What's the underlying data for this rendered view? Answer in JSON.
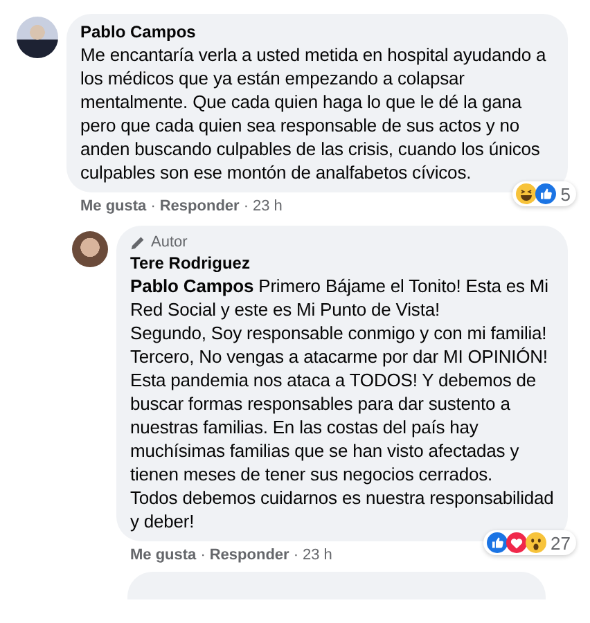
{
  "comments": [
    {
      "author": "Pablo Campos",
      "reply": false,
      "paragraphs": [
        "Me encantaría verla a usted metida en hospital ayudando a los médicos que ya están empezando a colapsar mentalmente. Que cada quien haga lo que le dé la gana pero que cada quien sea responsable de sus actos y no anden buscando culpables de las crisis, cuando los únicos culpables son ese montón de analfabetos cívicos."
      ],
      "reactions": [
        {
          "kind": "haha"
        },
        {
          "kind": "like"
        }
      ],
      "reaction_count": "5",
      "actions": [
        "Me gusta",
        "Responder"
      ],
      "separator": "·",
      "time": "23 h"
    },
    {
      "author": "Tere Rodriguez",
      "badge": "Autor",
      "reply": true,
      "paragraphs": [
        "**Pablo Campos** Primero Bájame el Tonito! Esta es Mi Red Social y este es Mi Punto de Vista!",
        "Segundo, Soy responsable conmigo y con mi familia!",
        "Tercero, No vengas a atacarme por dar MI OPINIÓN!",
        "Esta pandemia nos ataca a TODOS! Y debemos de buscar formas responsables para dar sustento a nuestras familias. En las costas del país hay muchísimas familias que se han visto afectadas y tienen meses de tener sus negocios cerrados.",
        "Todos debemos cuidarnos es nuestra responsabilidad y deber!"
      ],
      "reactions": [
        {
          "kind": "like"
        },
        {
          "kind": "love"
        },
        {
          "kind": "wow"
        }
      ],
      "reaction_count": "27",
      "actions": [
        "Me gusta",
        "Responder"
      ],
      "separator": "·",
      "time": "23 h"
    }
  ]
}
